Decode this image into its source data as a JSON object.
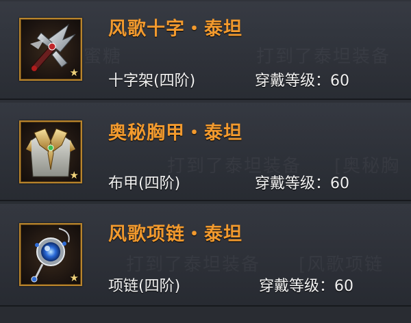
{
  "items": [
    {
      "name": "风歌十字・泰坦",
      "type": "十字架(四阶)",
      "req_label": "穿戴等级：",
      "req_value": "60",
      "icon": "cross-weapon-icon"
    },
    {
      "name": "奥秘胸甲・泰坦",
      "type": "布甲(四阶)",
      "req_label": "穿戴等级：",
      "req_value": "60",
      "icon": "chest-armor-icon"
    },
    {
      "name": "风歌项链・泰坦",
      "type": "项链(四阶)",
      "req_label": "穿戴等级：",
      "req_value": "60",
      "icon": "necklace-icon"
    }
  ],
  "background_chat": [
    "蜜糖",
    "打到了泰坦装备",
    "打到了泰坦装备",
    "[奥秘胸",
    "打到了泰坦装备",
    "[风歌项链"
  ],
  "colors": {
    "name": "#f29a2e",
    "text": "#f2f2f2",
    "frame": "#b8842c"
  }
}
